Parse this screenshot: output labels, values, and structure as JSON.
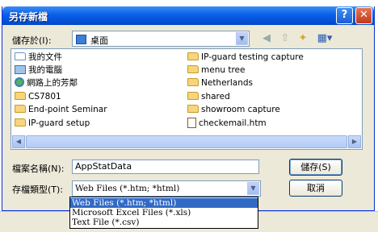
{
  "window": {
    "title": "另存新檔",
    "help_label": "?",
    "close_label": "✕"
  },
  "save_in": {
    "label": "儲存於(I):",
    "value": "桌面"
  },
  "files": [
    {
      "name": "我的文件",
      "icon": "documents-folder-icon"
    },
    {
      "name": "我的電腦",
      "icon": "computer-icon"
    },
    {
      "name": "網路上的芳鄰",
      "icon": "network-icon"
    },
    {
      "name": "CS7801",
      "icon": "folder-icon"
    },
    {
      "name": "End-point Seminar",
      "icon": "folder-icon"
    },
    {
      "name": "IP-guard setup",
      "icon": "folder-icon"
    },
    {
      "name": "IP-guard testing capture",
      "icon": "folder-icon"
    },
    {
      "name": "menu tree",
      "icon": "folder-icon"
    },
    {
      "name": "Netherlands",
      "icon": "folder-icon"
    },
    {
      "name": "shared",
      "icon": "folder-icon"
    },
    {
      "name": "showroom capture",
      "icon": "folder-icon"
    },
    {
      "name": "checkemail.htm",
      "icon": "html-file-icon"
    }
  ],
  "file_name": {
    "label": "檔案名稱(N):",
    "value": "AppStatData"
  },
  "file_type": {
    "label": "存檔類型(T):",
    "value": "Web Files (*.htm; *html)",
    "options": [
      "Web Files (*.htm; *html)",
      "Microsoft Excel Files (*.xls)",
      "Text File (*.csv)"
    ]
  },
  "buttons": {
    "save": "儲存(S)",
    "cancel": "取消"
  },
  "colors": {
    "titlebar": "#0a5fe8",
    "dialog_bg": "#ece9d8",
    "selection": "#316ac5"
  }
}
